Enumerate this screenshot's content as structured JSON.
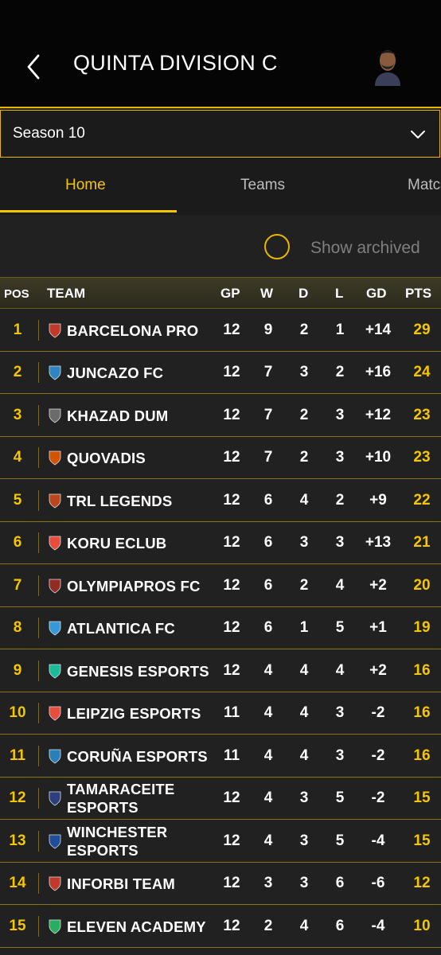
{
  "header": {
    "title": "QUINTA DIVISION C",
    "back_icon": "chevron-left-icon",
    "avatar_icon": "user-avatar-icon"
  },
  "season": {
    "label": "Season 10",
    "icon": "chevron-down-icon"
  },
  "tabs": [
    {
      "label": "Home",
      "active": true
    },
    {
      "label": "Teams",
      "active": false
    },
    {
      "label": "Matc",
      "active": false
    }
  ],
  "archived": {
    "label": "Show archived",
    "checked": false
  },
  "table": {
    "headers": {
      "pos": "POS",
      "team": "TEAM",
      "gp": "GP",
      "w": "W",
      "d": "D",
      "l": "L",
      "gd": "GD",
      "pts": "PTS"
    },
    "rows": [
      {
        "pos": "1",
        "team": "BARCELONA PRO",
        "gp": "12",
        "w": "9",
        "d": "2",
        "l": "1",
        "gd": "+14",
        "pts": "29",
        "crest": "#c0392b"
      },
      {
        "pos": "2",
        "team": "JUNCAZO FC",
        "gp": "12",
        "w": "7",
        "d": "3",
        "l": "2",
        "gd": "+16",
        "pts": "24",
        "crest": "#2e86c1"
      },
      {
        "pos": "3",
        "team": "KHAZAD DUM",
        "gp": "12",
        "w": "7",
        "d": "2",
        "l": "3",
        "gd": "+12",
        "pts": "23",
        "crest": "#6b6b6b"
      },
      {
        "pos": "4",
        "team": "QUOVADIS",
        "gp": "12",
        "w": "7",
        "d": "2",
        "l": "3",
        "gd": "+10",
        "pts": "23",
        "crest": "#d35400"
      },
      {
        "pos": "5",
        "team": "TRL LEGENDS",
        "gp": "12",
        "w": "6",
        "d": "4",
        "l": "2",
        "gd": "+9",
        "pts": "22",
        "crest": "#b9461f"
      },
      {
        "pos": "6",
        "team": "KORU ECLUB",
        "gp": "12",
        "w": "6",
        "d": "3",
        "l": "3",
        "gd": "+13",
        "pts": "21",
        "crest": "#e74c3c"
      },
      {
        "pos": "7",
        "team": "OLYMPIAPROS FC",
        "gp": "12",
        "w": "6",
        "d": "2",
        "l": "4",
        "gd": "+2",
        "pts": "20",
        "crest": "#922b21"
      },
      {
        "pos": "8",
        "team": "ATLANTICA FC",
        "gp": "12",
        "w": "6",
        "d": "1",
        "l": "5",
        "gd": "+1",
        "pts": "19",
        "crest": "#3498db"
      },
      {
        "pos": "9",
        "team": "GENESIS ESPORTS",
        "gp": "12",
        "w": "4",
        "d": "4",
        "l": "4",
        "gd": "+2",
        "pts": "16",
        "crest": "#1abc9c"
      },
      {
        "pos": "10",
        "team": "LEIPZIG ESPORTS",
        "gp": "11",
        "w": "4",
        "d": "4",
        "l": "3",
        "gd": "-2",
        "pts": "16",
        "crest": "#e74c3c"
      },
      {
        "pos": "11",
        "team": "CORUÑA ESPORTS",
        "gp": "11",
        "w": "4",
        "d": "4",
        "l": "3",
        "gd": "-2",
        "pts": "16",
        "crest": "#2980b9"
      },
      {
        "pos": "12",
        "team": "TAMARACEITE ESPORTS",
        "team_l1": "TAMARACEITE",
        "team_l2": "ESPORTS",
        "gp": "12",
        "w": "4",
        "d": "3",
        "l": "5",
        "gd": "-2",
        "pts": "15",
        "crest": "#2c3e80"
      },
      {
        "pos": "13",
        "team": "WINCHESTER ESPORTS",
        "team_l1": "WINCHESTER",
        "team_l2": "ESPORTS",
        "gp": "12",
        "w": "4",
        "d": "3",
        "l": "5",
        "gd": "-4",
        "pts": "15",
        "crest": "#1f4e9c"
      },
      {
        "pos": "14",
        "team": "INFORBI TEAM",
        "gp": "12",
        "w": "3",
        "d": "3",
        "l": "6",
        "gd": "-6",
        "pts": "12",
        "crest": "#c0392b"
      },
      {
        "pos": "15",
        "team": "ELEVEN ACADEMY",
        "gp": "12",
        "w": "2",
        "d": "4",
        "l": "6",
        "gd": "-4",
        "pts": "10",
        "crest": "#27ae60"
      }
    ]
  },
  "colors": {
    "accent": "#f5c500",
    "background": "#212121",
    "header_bg": "#050505"
  }
}
